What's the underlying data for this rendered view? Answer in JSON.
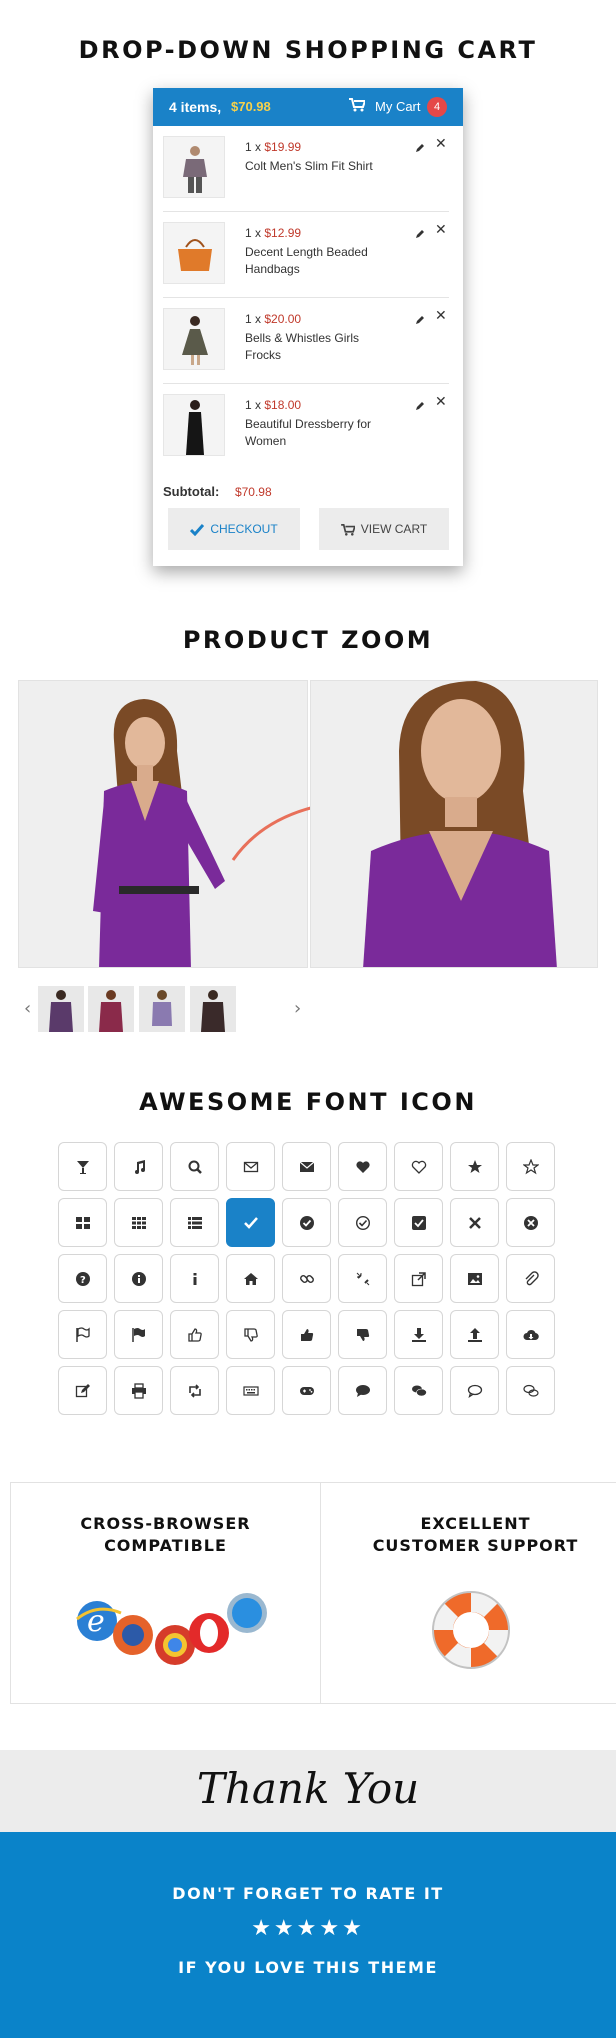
{
  "cart_section": {
    "title": "DROP-DOWN SHOPPING CART",
    "header": {
      "items_label": "4 items,",
      "total": "$70.98",
      "my_cart": "My Cart",
      "badge": "4"
    },
    "items": [
      {
        "qty": "1 x",
        "price": "$19.99",
        "name": "Colt Men's Slim Fit Shirt"
      },
      {
        "qty": "1 x",
        "price": "$12.99",
        "name": "Decent Length Beaded Handbags"
      },
      {
        "qty": "1 x",
        "price": "$20.00",
        "name": "Bells & Whistles Girls Frocks"
      },
      {
        "qty": "1 x",
        "price": "$18.00",
        "name": "Beautiful Dressberry for Women"
      }
    ],
    "subtotal_label": "Subtotal:",
    "subtotal_value": "$70.98",
    "checkout_label": "CHECKOUT",
    "viewcart_label": "VIEW CART"
  },
  "zoom_section": {
    "title": "PRODUCT ZOOM",
    "prev_glyph": "‹",
    "next_glyph": "›"
  },
  "icons_section": {
    "title": "AWESOME FONT ICON",
    "icons": [
      "glass-icon",
      "music-icon",
      "search-icon",
      "envelope-o-icon",
      "envelope-icon",
      "heart-icon",
      "heart-o-icon",
      "star-icon",
      "star-o-icon",
      "th-large-icon",
      "th-icon",
      "th-list-icon",
      "check-icon",
      "check-circle-icon",
      "check-circle-o-icon",
      "check-square-icon",
      "times-icon",
      "times-circle-icon",
      "question-circle-icon",
      "info-circle-icon",
      "info-icon",
      "home-icon",
      "link-icon",
      "unlink-icon",
      "external-link-icon",
      "picture-icon",
      "paperclip-icon",
      "flag-o-icon",
      "flag-checkered-icon",
      "thumbs-o-up-icon",
      "thumbs-o-down-icon",
      "thumbs-up-icon",
      "thumbs-down-icon",
      "download-icon",
      "upload-icon",
      "cloud-download-icon",
      "edit-icon",
      "print-icon",
      "retweet-icon",
      "keyboard-icon",
      "gamepad-icon",
      "comment-icon",
      "comments-icon",
      "comment-o-icon",
      "comments-o-icon"
    ],
    "active_index": 12,
    "accent": "#1a82c8"
  },
  "features": [
    {
      "title_line1": "CROSS-BROWSER",
      "title_line2": "COMPATIBLE",
      "icon": "browser-logos-icon"
    },
    {
      "title_line1": "EXCELLENT",
      "title_line2": "CUSTOMER SUPPORT",
      "icon": "lifebuoy-icon"
    }
  ],
  "footer": {
    "thanks": "Thank You",
    "rate": "DON'T FORGET TO RATE IT",
    "stars": "★★★★★",
    "love": "IF YOU LOVE THIS THEME",
    "band_color": "#0a83c9"
  }
}
